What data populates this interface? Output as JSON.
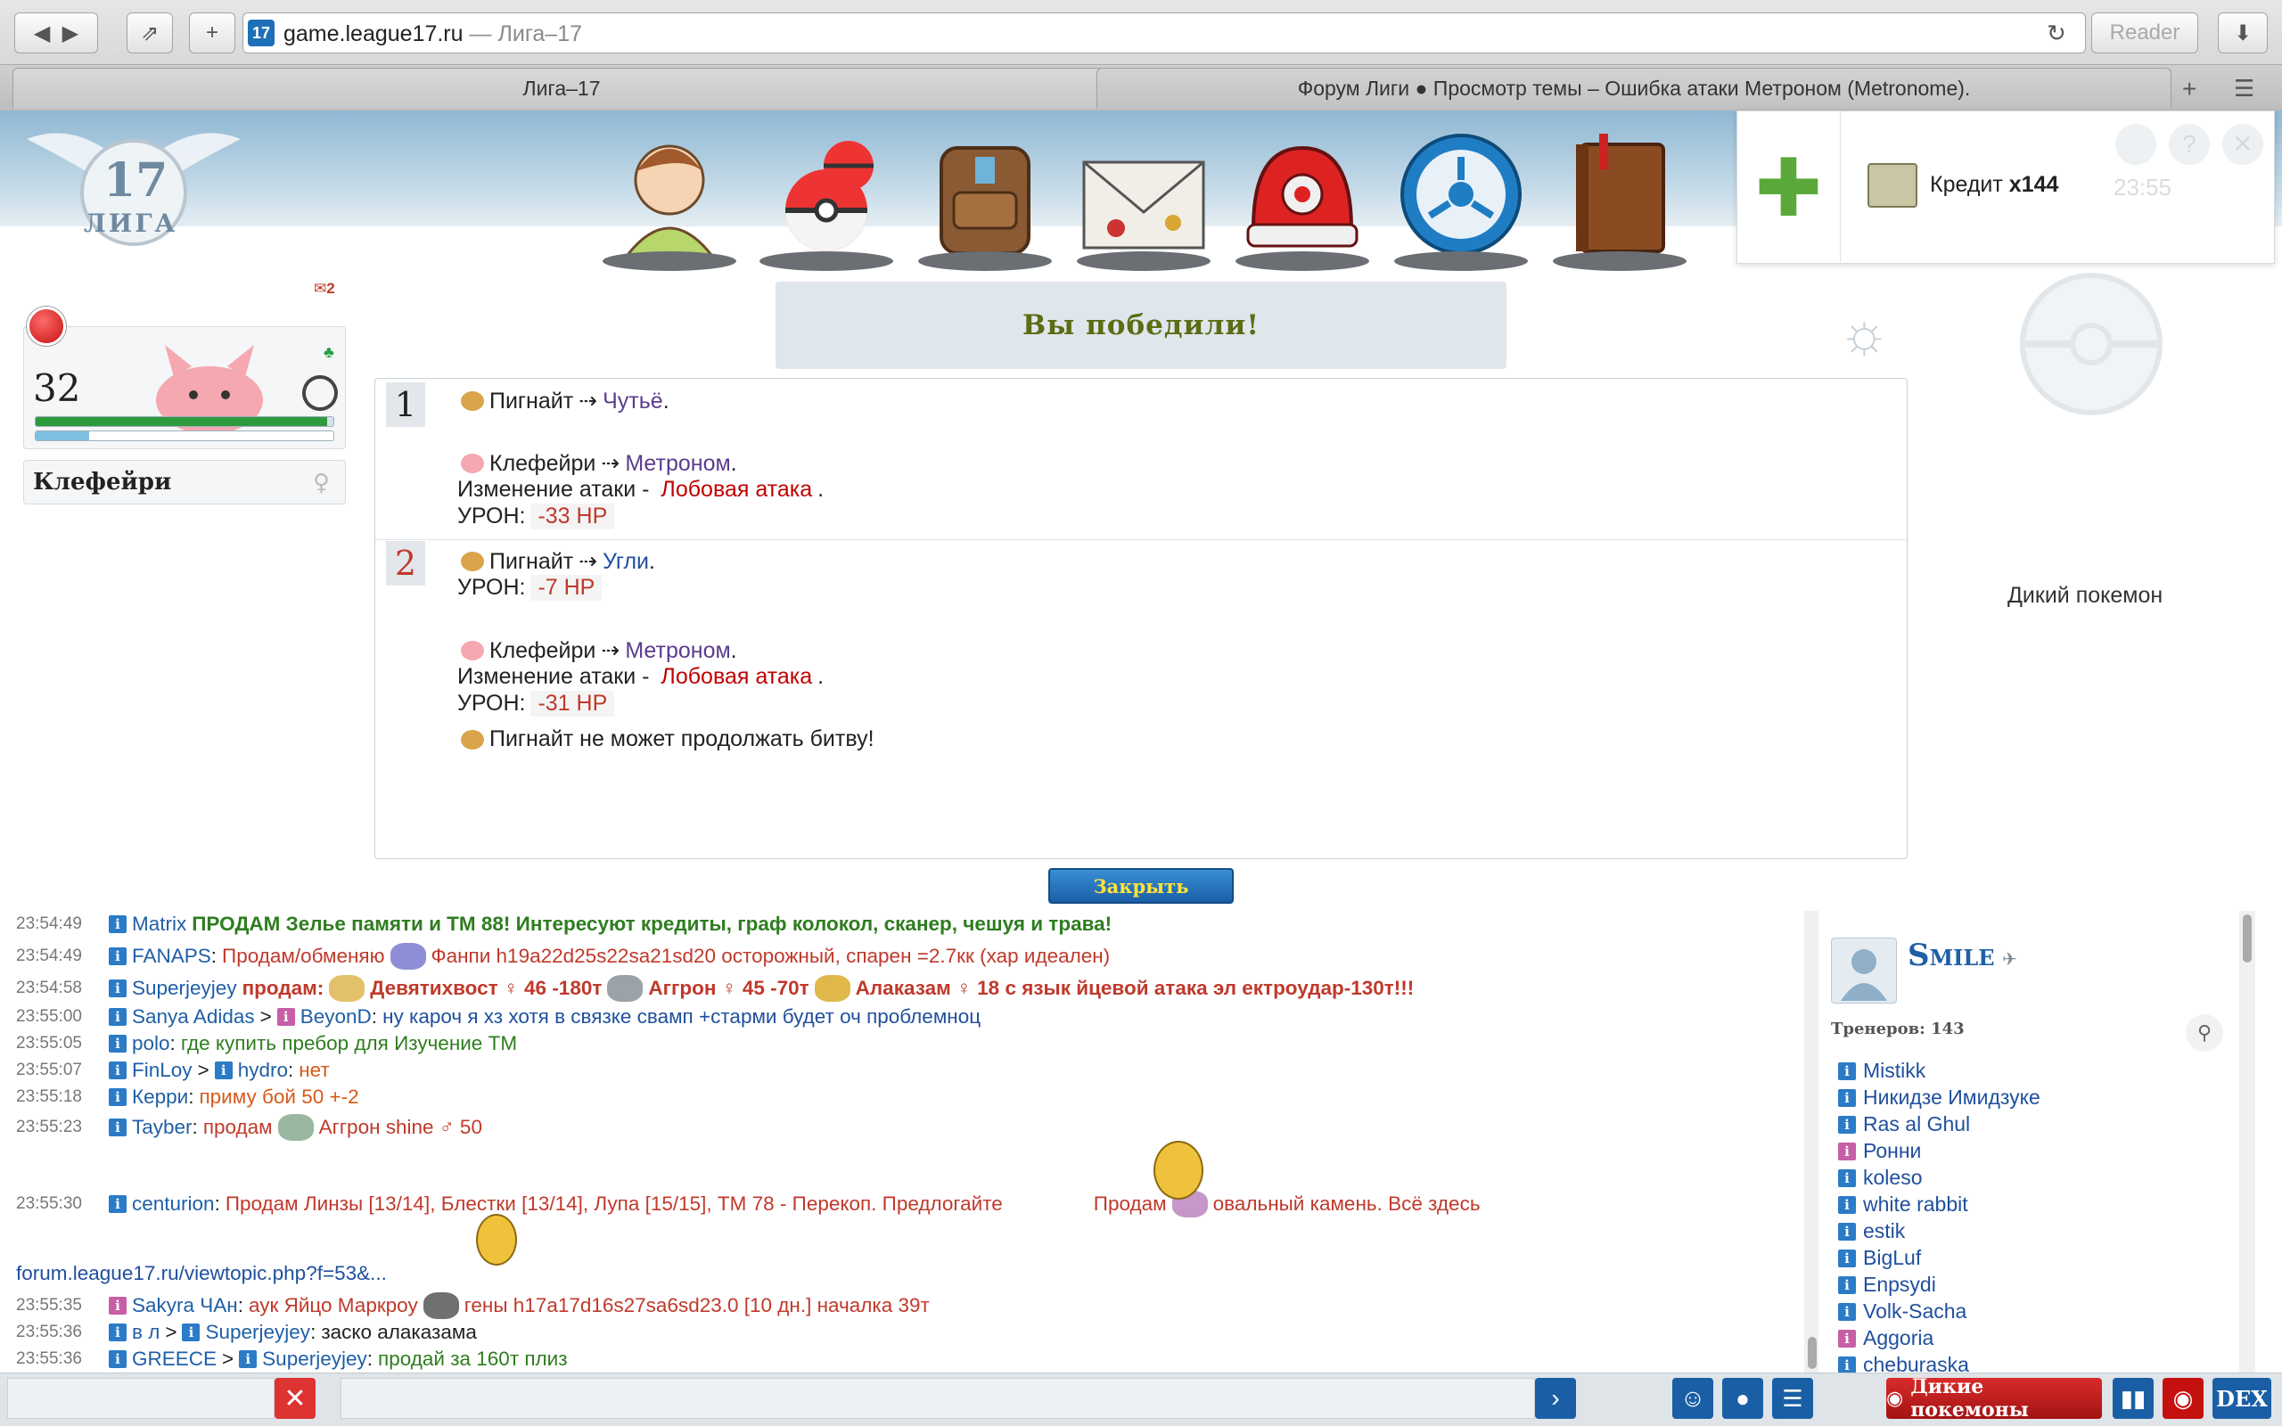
{
  "browser": {
    "url": "game.league17.ru",
    "url_title": "— Лига–17",
    "reader_label": "Reader",
    "tabs": [
      {
        "label": "Лига–17"
      },
      {
        "label": "Форум Лиги ● Просмотр темы – Ошибка атаки Метроном (Metronome)."
      }
    ],
    "new_tab_label": "+",
    "favicon_text": "17"
  },
  "header": {
    "logo_number": "17",
    "logo_text": "ЛИГА",
    "nav_icons": [
      "trainer-icon",
      "pokeballs-icon",
      "backpack-icon",
      "mail-icon",
      "cap-icon",
      "league-icon",
      "pokedex-book-icon"
    ]
  },
  "credit": {
    "label": "Кредит",
    "amount": "x144",
    "clock": "23:55",
    "add_icon": "plus-icon"
  },
  "player_pokemon": {
    "name": "Клефейри",
    "level": "32",
    "hp_fraction": 0.98,
    "exp_fraction": 0.18,
    "notice_count": "2"
  },
  "battle": {
    "result": "Вы победили!",
    "close_label": "Закрыть",
    "wild_label": "Дикий покемон",
    "turns": [
      {
        "number": "1",
        "lines": [
          {
            "actor": "Пигнайт",
            "arrow": "⇢",
            "move": "Чутьё",
            "end": "."
          },
          {
            "actor": "Клефейри",
            "arrow": "⇢",
            "move": "Метроном",
            "end": "."
          },
          {
            "text": "Изменение атаки - ",
            "attack": "Лобовая атака",
            "end": "."
          },
          {
            "text": "УРОН:",
            "damage": "-33 HP"
          }
        ]
      },
      {
        "number": "2",
        "lines": [
          {
            "actor": "Пигнайт",
            "arrow": "⇢",
            "move": "Угли",
            "end": "."
          },
          {
            "text": "УРОН:",
            "damage": "-7 HP"
          },
          {
            "actor": "Клефейри",
            "arrow": "⇢",
            "move": "Метроном",
            "end": "."
          },
          {
            "text": "Изменение атаки - ",
            "attack": "Лобовая атака",
            "end": "."
          },
          {
            "text": "УРОН:",
            "damage": "-31 HP"
          },
          {
            "actor": "Пигнайт",
            "text": " не может продолжать битву!"
          }
        ]
      }
    ]
  },
  "chat": {
    "messages": [
      {
        "time": "23:54:49",
        "user": "Matrix",
        "text": "ПРОДАМ Зелье памяти и ТМ 88! Интересуют кредиты, граф колокол, сканер, чешуя и трава!"
      },
      {
        "time": "23:54:49",
        "user": "FANAPS",
        "text1": "Продам/обменяю",
        "text2": "Фанпи h19a22d25s22sa21sd20 осторожный, спарен =2.7кк (хар идеален)"
      },
      {
        "time": "23:54:58",
        "user": "Superjeyjey",
        "lead": "продам:",
        "p1": "Девятихвост ♀ 46 -180т",
        "p2": "Аггрон ♀ 45 -70т",
        "p3": "Алаказам ♀ 18 с язык йцевой атака эл ектроудар-130т!!!"
      },
      {
        "time": "23:55:00",
        "user": "Sanya Adidas",
        "to": "BeyonD",
        "text": "ну кароч я хз хотя в связке свамп +старми будет оч проблемноц"
      },
      {
        "time": "23:55:05",
        "user": "polo",
        "text": "где купить пребор для Изучение ТМ"
      },
      {
        "time": "23:55:07",
        "user": "FinLoy",
        "to": "hydro",
        "text": "нет"
      },
      {
        "time": "23:55:18",
        "user": "Керри",
        "text": "приму бой 50 +-2"
      },
      {
        "time": "23:55:23",
        "user": "Tayber",
        "text1": "продам",
        "text2": "Аггрон shine ♂ 50"
      },
      {
        "time": "23:55:30",
        "user": "centurion",
        "text1": "Продам Линзы [13/14], Блестки [13/14], Лупа [15/15], ТМ 78 - Перекоп. Предлогайте",
        "text2": "Продам",
        "text3": "овальный камень. Всё здесь"
      },
      {
        "link": "forum.league17.ru/viewtopic.php?f=53&..."
      },
      {
        "time": "23:55:35",
        "user": "Sakyra ЧАн",
        "text1": "аук Яйцо Маркроу",
        "text2": "гены h17a17d16s27sa6sd23.0 [10 дн.] началка 39т"
      },
      {
        "time": "23:55:36",
        "user": "в л",
        "to": "Superjeyjey",
        "text": "заско алаказама"
      },
      {
        "time": "23:55:36",
        "user": "GREECE",
        "to": "Superjeyjey",
        "text": "продай за 160т плиз"
      }
    ]
  },
  "online": {
    "title": "Smile",
    "trainers_label": "Тренеров: 143",
    "users": [
      "Mistikk",
      "Никидзе Имидзуке",
      "Ras al Ghul",
      "Ронни",
      "koleso",
      "white rabbit",
      "estik",
      "BigLuf",
      "Enpsydi",
      "Volk-Sacha",
      "Aggoria",
      "cheburaska"
    ]
  },
  "bottom": {
    "wild_button": "Дикие покемоны",
    "dex_button": "DEX"
  },
  "colors": {
    "accent": "#1a5fa6",
    "result_text": "#5c6d13",
    "damage": "#c0392b",
    "hp_bar": "#2e9a3e",
    "exp_bar": "#7fbfdf",
    "close_text": "#ffe33a",
    "wild_button": "#b71c1c"
  }
}
